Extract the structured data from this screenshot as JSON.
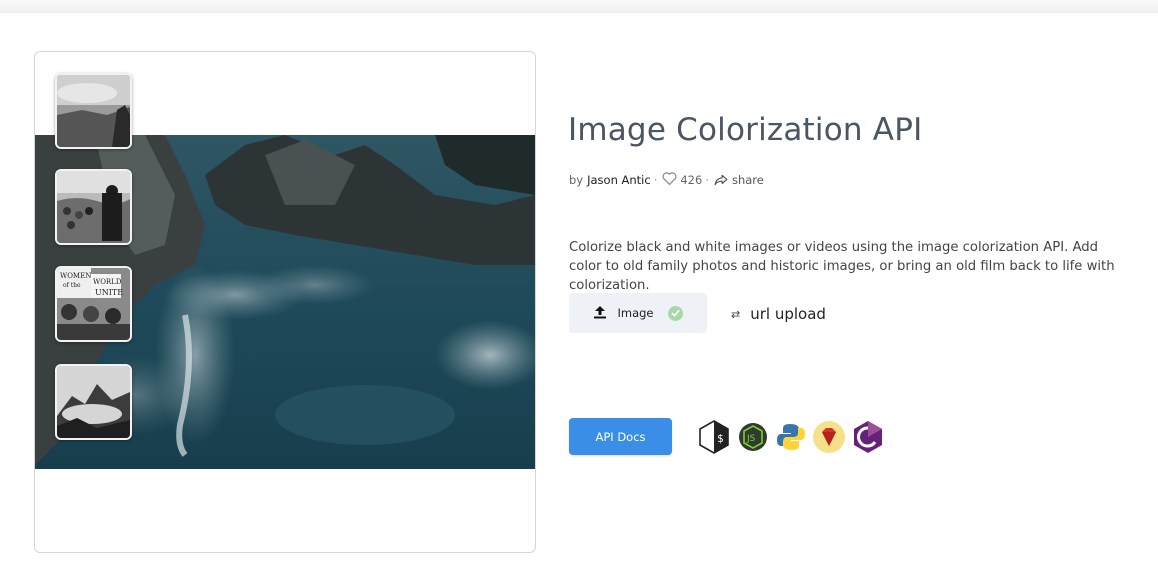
{
  "page": {
    "title": "Image Colorization API",
    "by_label": "by",
    "author": "Jason Antic",
    "likes": "426",
    "share_label": "share",
    "description": "Colorize black and white images or videos using the image colorization API. Add color to old family photos and historic images, or bring an old film back to life with colorization."
  },
  "upload": {
    "image_tab_label": "Image",
    "url_tab_label": "url upload"
  },
  "api_docs_label": "API Docs",
  "language_icons": [
    "shell-icon",
    "nodejs-icon",
    "python-icon",
    "ruby-icon",
    "csharp-icon"
  ],
  "thumbnails": [
    "landscape-bw-thumbnail",
    "crowd-speech-bw-thumbnail",
    "protest-signs-bw-thumbnail",
    "mountain-mist-bw-thumbnail"
  ],
  "colors": {
    "title": "#4b5563",
    "api_button": "#3a8ee6",
    "upload_tab_bg": "#eef2f6",
    "check": "#a8d8a8"
  }
}
